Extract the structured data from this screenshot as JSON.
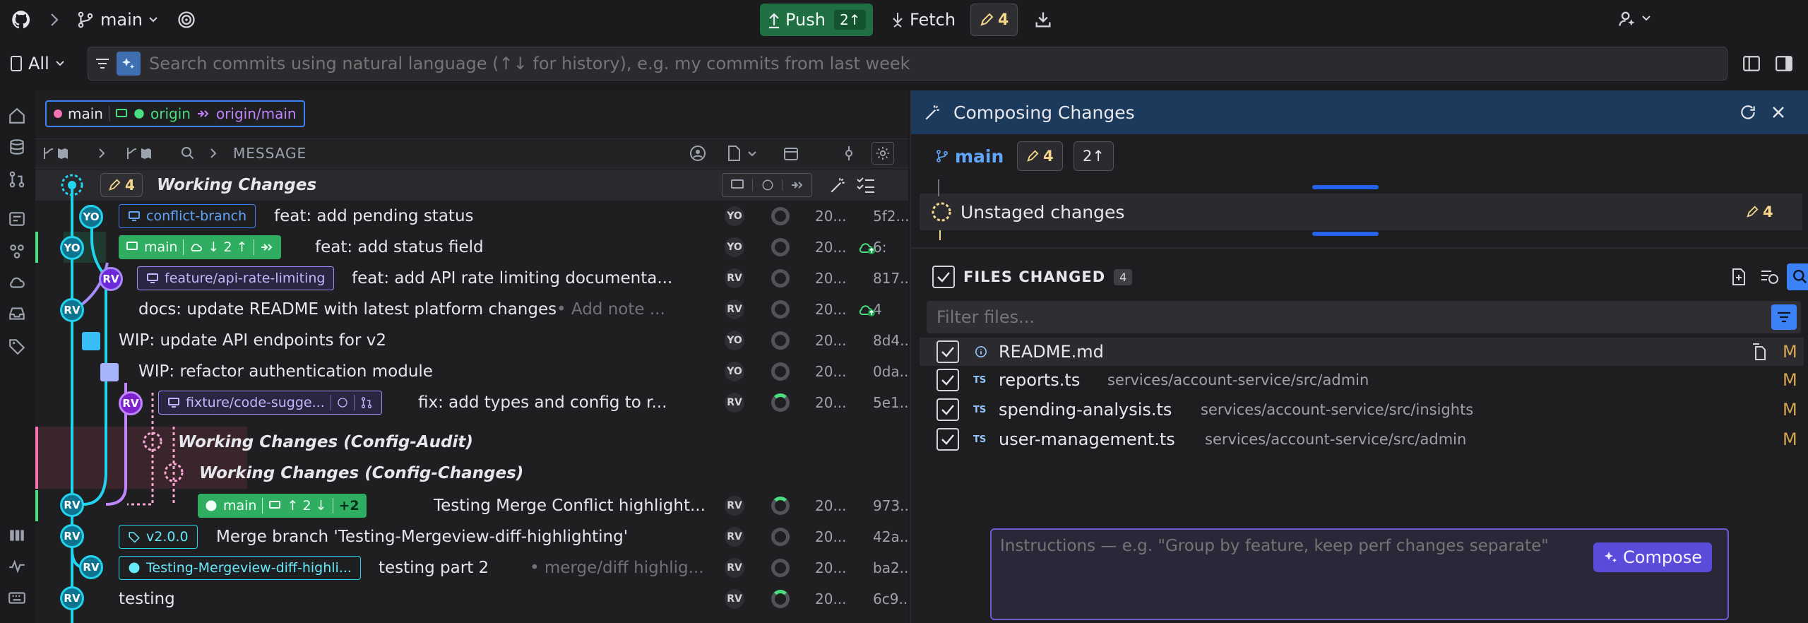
{
  "topbar": {
    "branch": "main",
    "push_label": "Push",
    "push_count": "2↑",
    "fetch_label": "Fetch",
    "changes_count": "4"
  },
  "search": {
    "scope": "All",
    "placeholder": "Search commits using natural language (↑↓ for history), e.g. my commits from last week"
  },
  "graph": {
    "head_refs": {
      "local": "main",
      "remote": "origin",
      "remote_branch": "origin/main"
    },
    "header_message": "MESSAGE",
    "rows": [
      {
        "title": "Working Changes",
        "count": "4"
      },
      {
        "tag": "conflict-branch",
        "message": "feat: add pending status",
        "author": "YO",
        "date": "20...",
        "sha": "5f2..."
      },
      {
        "tag": "main",
        "tag_counts": "↓ 2 ↑",
        "message": "feat: add status field",
        "author": "YO",
        "date": "20...",
        "sha": "6:"
      },
      {
        "tag": "feature/api-rate-limiting",
        "message": "feat: add API rate limiting documenta...",
        "author": "RV",
        "date": "20...",
        "sha": "817..."
      },
      {
        "message": "docs: update README with latest platform changes",
        "note": "• Add note ...",
        "author": "RV",
        "date": "20...",
        "sha": "4"
      },
      {
        "message": "WIP: update API endpoints for v2",
        "author": "YO",
        "date": "20...",
        "sha": "8d4..."
      },
      {
        "message": "WIP: refactor authentication module",
        "author": "YO",
        "date": "20...",
        "sha": "0da..."
      },
      {
        "tag": "fixture/code-sugge...",
        "message": "fix: add types and config to r...",
        "author": "RV",
        "date": "20...",
        "sha": "5e1..."
      },
      {
        "title": "Working Changes (Config-Audit)"
      },
      {
        "title": "Working Changes (Config-Changes)"
      },
      {
        "tag": "main",
        "tag_counts": "↑ 2 ↓",
        "tag_extra": "+2",
        "message": "Testing Merge Conflict highlight...",
        "author": "RV",
        "date": "20...",
        "sha": "973..."
      },
      {
        "tag": "v2.0.0",
        "message": "Merge branch 'Testing-Mergeview-diff-highlighting'",
        "author": "RV",
        "date": "20...",
        "sha": "42a..."
      },
      {
        "tag": "Testing-Mergeview-diff-highli...",
        "message": "testing part 2",
        "note": "• merge/diff highlig...",
        "author": "RV",
        "date": "20...",
        "sha": "ba2..."
      },
      {
        "message": "testing",
        "author": "RV",
        "date": "20...",
        "sha": "6c9..."
      }
    ],
    "avatars": [
      "YO",
      "YO",
      "RV",
      "RV",
      "RV",
      "RV",
      "RV",
      "RV",
      "RV"
    ]
  },
  "panel": {
    "title": "Composing Changes",
    "branch": "main",
    "changes_count": "4",
    "ahead_count": "2↑",
    "unstaged_label": "Unstaged changes",
    "unstaged_count": "4",
    "files_changed_label": "FILES CHANGED",
    "files_count": "4",
    "filter_placeholder": "Filter files...",
    "files": [
      {
        "name": "README.md",
        "path": "",
        "status": "M",
        "type": "info"
      },
      {
        "name": "reports.ts",
        "path": "services/account-service/src/admin",
        "status": "M",
        "type": "TS"
      },
      {
        "name": "spending-analysis.ts",
        "path": "services/account-service/src/insights",
        "status": "M",
        "type": "TS"
      },
      {
        "name": "user-management.ts",
        "path": "services/account-service/src/admin",
        "status": "M",
        "type": "TS"
      }
    ],
    "instructions_placeholder": "Instructions — e.g. \"Group by feature, keep perf changes separate\"",
    "compose_label": "Compose"
  },
  "colors": {
    "accent_blue": "#3b82f6",
    "push_green": "#1f6f43",
    "lane_cyan": "#22d3ee",
    "lane_purple": "#a78bfa",
    "compose_purple": "#5b4bdb",
    "panel_header": "#1c3a5c"
  }
}
